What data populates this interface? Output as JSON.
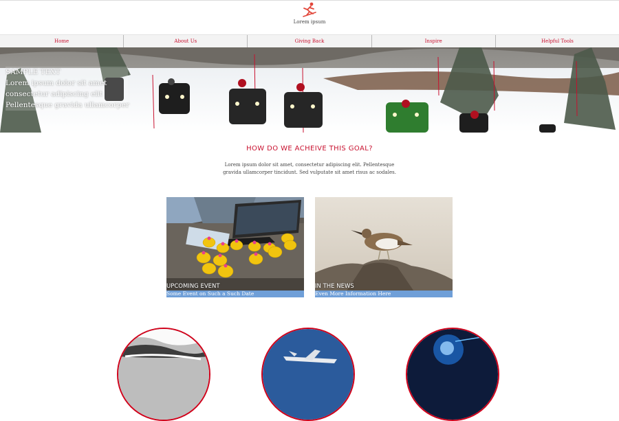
{
  "header": {
    "logo_text": "Lorem ipsum",
    "logo_icon": "skier-icon"
  },
  "nav": {
    "items": [
      {
        "label": "Home"
      },
      {
        "label": "About Us"
      },
      {
        "label": "Giving Back"
      },
      {
        "label": "Inspire"
      },
      {
        "label": "Helpful Tools"
      }
    ]
  },
  "hero": {
    "lines": [
      "SAMPLE TEXT",
      "Lorem ipsum dolor sit amet",
      "consectetur adipiscing elit",
      "Pellentesque gravida ullamcorper"
    ]
  },
  "goal": {
    "title": "HOW DO WE ACHEIVE THIS GOAL?",
    "body": "Lorem ipsum dolor sit amet, consectetur adipiscing elit. Pellentesque gravida ullamcorper tincidunt. Sed vulputate sit amet risus ac sodales."
  },
  "cards": [
    {
      "title": "UPCOMING EVENT",
      "subtitle": "Some Event on Such a Such Date"
    },
    {
      "title": "IN THE NEWS",
      "subtitle": "Even More Information Here"
    }
  ],
  "colors": {
    "accent": "#c8102e",
    "caption_bar": "#6f9fd8"
  }
}
